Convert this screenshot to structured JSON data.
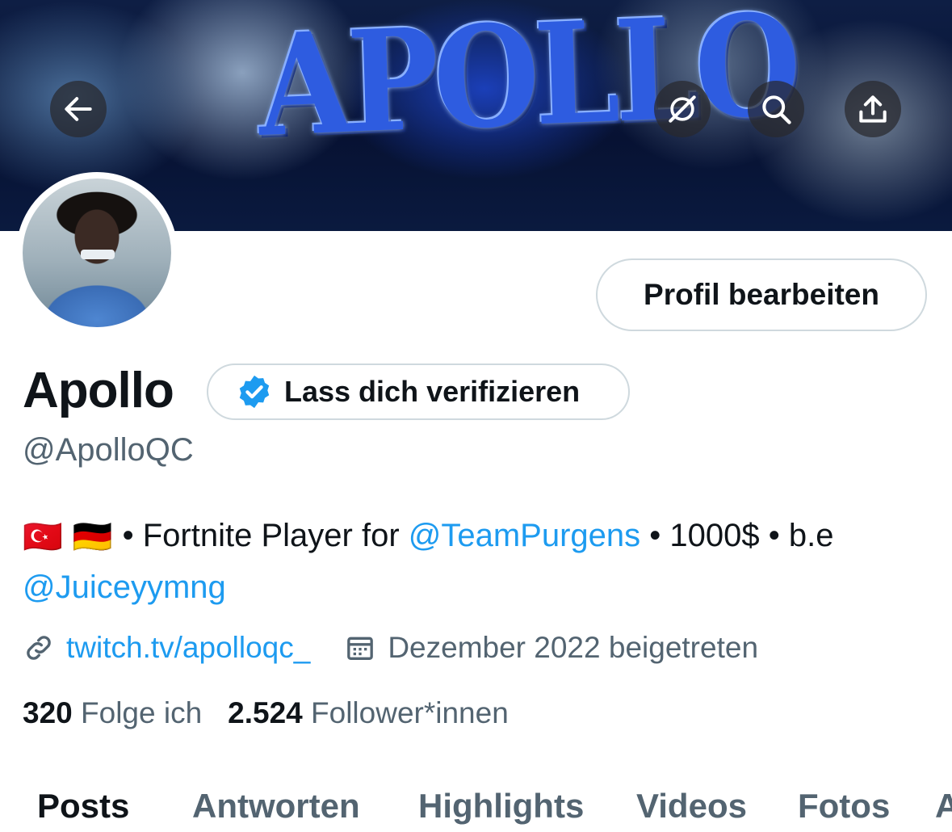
{
  "banner": {
    "title": "APOLLO",
    "back_icon": "arrow-left-icon",
    "grok_icon": "grok-icon",
    "search_icon": "search-icon",
    "share_icon": "share-icon"
  },
  "profile": {
    "avatar": "avatar",
    "edit_label": "Profil bearbeiten",
    "name": "Apollo",
    "verify_label": "Lass dich verifizieren",
    "verify_icon": "verified-badge-icon",
    "handle": "@ApolloQC",
    "bio": {
      "flags": [
        "🇹🇷",
        "🇩🇪"
      ],
      "text_1": "• Fortnite Player for ",
      "mention_1": "@TeamPurgens",
      "text_2": " • 1000$ • b.e",
      "mention_2": "@Juiceyymng"
    },
    "link_icon": "link-icon",
    "website": "twitch.tv/apolloqc_",
    "calendar_icon": "calendar-icon",
    "joined": "Dezember 2022 beigetreten",
    "following_count": "320",
    "following_label": "Folge ich",
    "followers_count": "2.524",
    "followers_label": "Follower*innen"
  },
  "tabs": [
    "Posts",
    "Antworten",
    "Highlights",
    "Videos",
    "Fotos",
    "A"
  ],
  "colors": {
    "accent": "#1d9bf0",
    "text": "#0f1419",
    "secondary": "#536471",
    "border": "#cfd9de"
  }
}
